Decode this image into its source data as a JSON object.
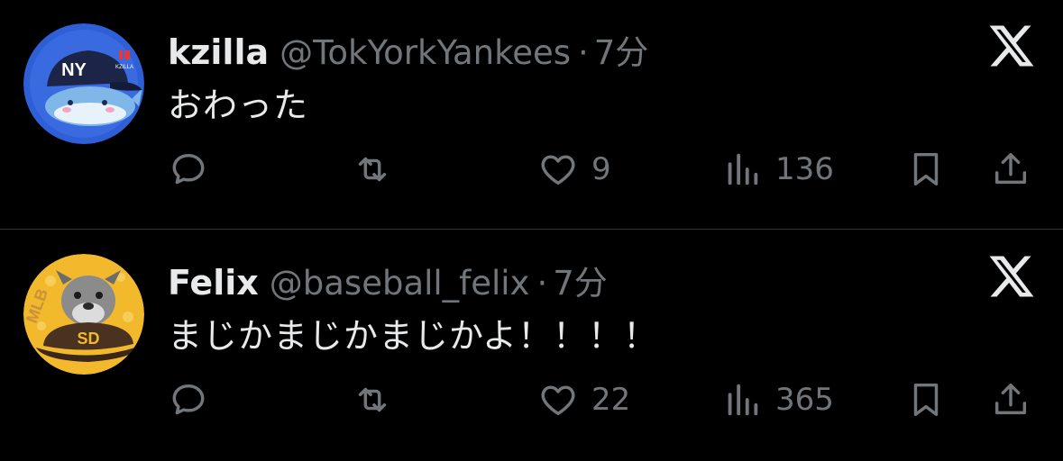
{
  "colors": {
    "background": "#000000",
    "primary_text": "#e7e9ea",
    "secondary_text": "#71767b",
    "divider": "#2f3336"
  },
  "tweets": [
    {
      "name": "kzilla",
      "handle": "@TokYorkYankees",
      "separator": "·",
      "time": "7分",
      "text": "おわった",
      "reply_count": "",
      "retweet_count": "",
      "like_count": "9",
      "view_count": "136",
      "avatar": {
        "icon": "whale-with-ny-cap-avatar",
        "cap_text": "NY",
        "logo_text": "KZILLA"
      }
    },
    {
      "name": "Felix",
      "handle": "@baseball_felix",
      "separator": "·",
      "time": "7分",
      "text": "まじかまじかまじかよ！！！！",
      "reply_count": "",
      "retweet_count": "",
      "like_count": "22",
      "view_count": "365",
      "avatar": {
        "icon": "schnauzer-in-padres-cap-avatar",
        "side_text": "MLB"
      }
    }
  ],
  "icons": {
    "brand": "x-logo-icon",
    "reply": "reply-icon",
    "retweet": "retweet-icon",
    "like": "heart-icon",
    "views": "views-chart-icon",
    "bookmark": "bookmark-icon",
    "share": "share-icon"
  }
}
